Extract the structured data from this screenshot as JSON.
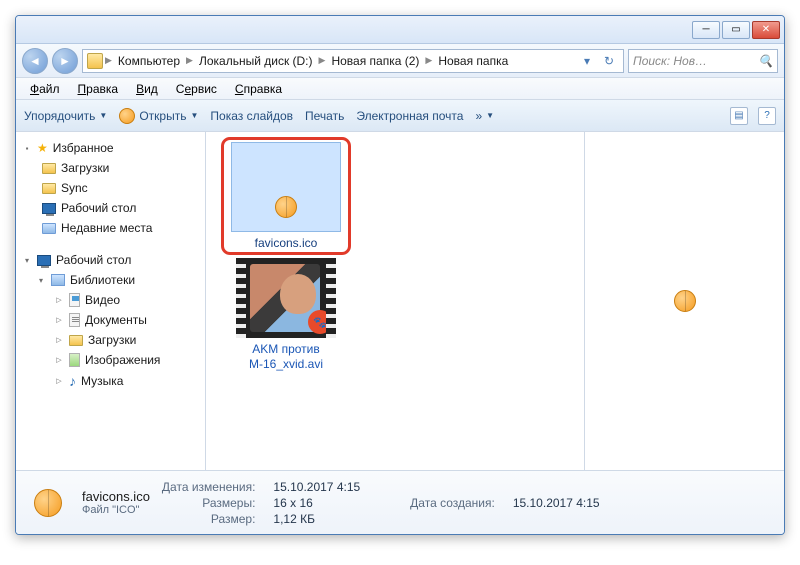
{
  "breadcrumb": [
    "Компьютер",
    "Локальный диск (D:)",
    "Новая папка (2)",
    "Новая папка"
  ],
  "search_placeholder": "Поиск: Нов…",
  "menu": {
    "file": "Файл",
    "edit": "Правка",
    "view": "Вид",
    "tools": "Сервис",
    "help": "Справка"
  },
  "toolbar": {
    "organize": "Упорядочить",
    "open": "Открыть",
    "slideshow": "Показ слайдов",
    "print": "Печать",
    "email": "Электронная почта",
    "overflow": "»"
  },
  "sidebar": {
    "favorites": {
      "label": "Избранное",
      "items": [
        "Загрузки",
        "Sync",
        "Рабочий стол",
        "Недавние места"
      ]
    },
    "desktop": {
      "label": "Рабочий стол"
    },
    "libraries": {
      "label": "Библиотеки",
      "items": [
        "Видео",
        "Документы",
        "Загрузки",
        "Изображения",
        "Музыка"
      ]
    }
  },
  "files": [
    {
      "name": "favicons.ico",
      "selected": true,
      "kind": "icon"
    },
    {
      "name": "AKM против М-16_xvid.avi",
      "selected": false,
      "kind": "video"
    }
  ],
  "details": {
    "filename": "favicons.ico",
    "filetype": "Файл \"ICO\"",
    "labels": {
      "modified": "Дата изменения:",
      "dimensions": "Размеры:",
      "size": "Размер:",
      "created": "Дата создания:"
    },
    "modified": "15.10.2017 4:15",
    "dimensions": "16 x 16",
    "size": "1,12 КБ",
    "created": "15.10.2017 4:15"
  }
}
